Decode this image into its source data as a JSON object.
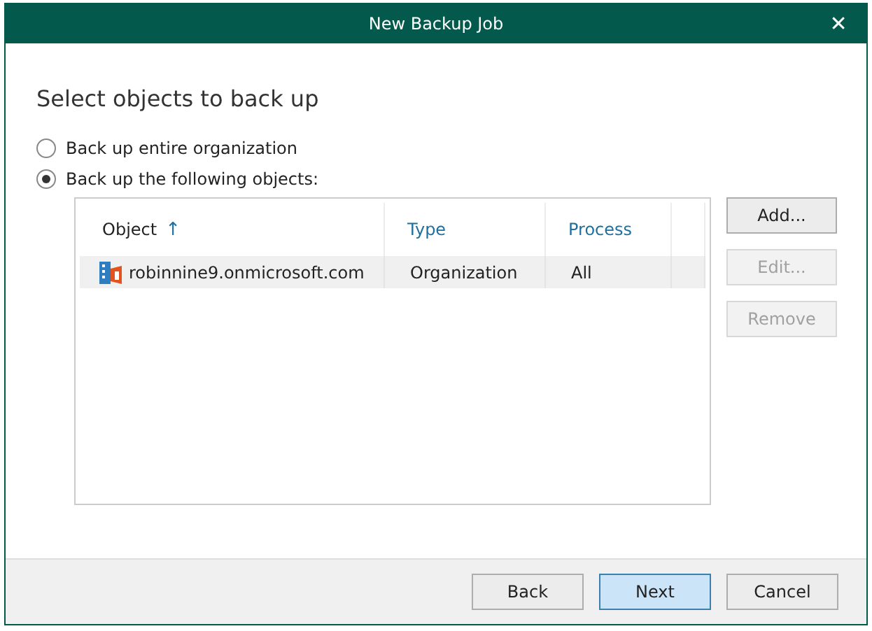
{
  "window": {
    "title": "New Backup Job",
    "close": "✕"
  },
  "heading": "Select objects to back up",
  "options": [
    {
      "label": "Back up entire organization",
      "selected": false
    },
    {
      "label": "Back up the following objects:",
      "selected": true
    }
  ],
  "table": {
    "columns": [
      {
        "label": "Object",
        "sort": "↑"
      },
      {
        "label": "Type"
      },
      {
        "label": "Process"
      }
    ],
    "rows": [
      {
        "object": "robinnine9.onmicrosoft.com",
        "type": "Organization",
        "process": "All",
        "selected": true
      }
    ]
  },
  "side_buttons": [
    {
      "label": "Add...",
      "disabled": false
    },
    {
      "label": "Edit...",
      "disabled": true
    },
    {
      "label": "Remove",
      "disabled": true
    }
  ],
  "footer_buttons": [
    {
      "label": "Back",
      "highlighted": false
    },
    {
      "label": "Next",
      "highlighted": true
    },
    {
      "label": "Cancel",
      "highlighted": false
    }
  ]
}
